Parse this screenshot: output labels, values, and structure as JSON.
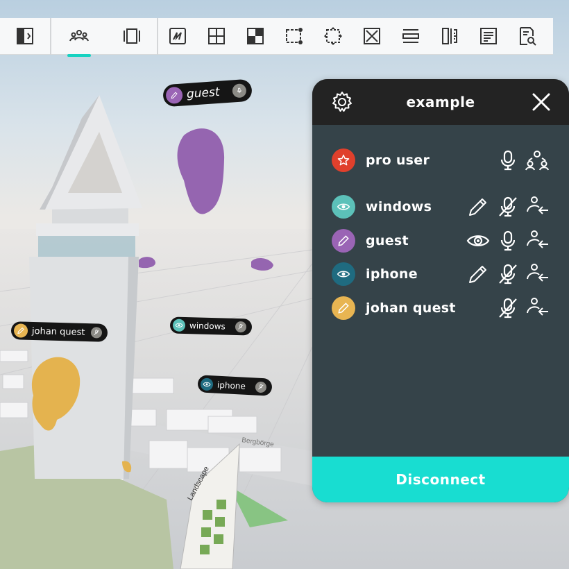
{
  "toolbar": {
    "buttons": [
      {
        "id": "panel-toggle",
        "icon": "sidebar-panel-icon"
      },
      {
        "id": "users",
        "icon": "users-group-icon",
        "active": true
      },
      {
        "id": "frame",
        "icon": "frame-icon"
      },
      {
        "id": "sketch",
        "icon": "sketch-icon"
      },
      {
        "id": "grid",
        "icon": "grid-add-icon"
      },
      {
        "id": "checker",
        "icon": "checker-icon"
      },
      {
        "id": "node",
        "icon": "node-shape-icon"
      },
      {
        "id": "transform",
        "icon": "transform-icon"
      },
      {
        "id": "crop",
        "icon": "crop-x-icon"
      },
      {
        "id": "section",
        "icon": "section-icon"
      },
      {
        "id": "measure",
        "icon": "measure-icon"
      },
      {
        "id": "notes",
        "icon": "notes-icon"
      },
      {
        "id": "search-doc",
        "icon": "search-document-icon"
      }
    ],
    "accent": "#17d2c1"
  },
  "scene": {
    "nameplates": [
      {
        "name": "guest",
        "role": "editor",
        "color": "#9a64b5"
      },
      {
        "name": "johan quest",
        "role": "editor",
        "color": "#e8b552"
      },
      {
        "name": "windows",
        "role": "viewer",
        "color": "#5cc1b9"
      },
      {
        "name": "iphone",
        "role": "viewer",
        "color": "#1f6b80"
      }
    ],
    "billboard_title": "Landscape",
    "street_label": "Bergbörge"
  },
  "panel": {
    "title": "example",
    "users": [
      {
        "name": "pro user",
        "avatar": "star-icon",
        "color": "#e0402c",
        "mic": "on",
        "action": "host-icon"
      },
      {
        "name": "windows",
        "avatar": "eye-icon",
        "color": "#5cc1b9",
        "mode": "pencil-icon",
        "mic": "off",
        "action": "request-icon"
      },
      {
        "name": "guest",
        "avatar": "pencil-icon",
        "color": "#9a64b5",
        "mode": "eye-icon",
        "mic": "on",
        "action": "request-icon"
      },
      {
        "name": "iphone",
        "avatar": "eye-icon",
        "color": "#1f6b80",
        "mode": "pencil-icon",
        "mic": "off",
        "action": "request-icon"
      },
      {
        "name": "johan quest",
        "avatar": "pencil-icon",
        "color": "#e8b552",
        "mic": "off",
        "action": "request-icon"
      }
    ],
    "disconnect_label": "Disconnect",
    "colors": {
      "header": "#232323",
      "body": "#354349",
      "button": "#18ddd1"
    }
  }
}
